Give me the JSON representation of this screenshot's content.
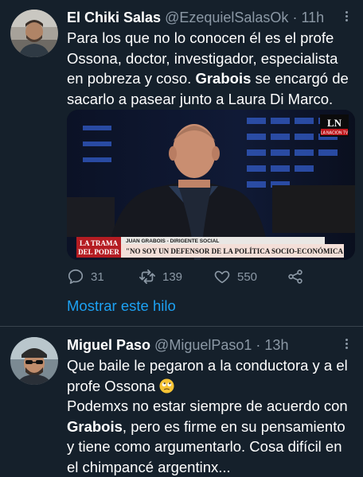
{
  "tweets": [
    {
      "author_name": "El Chiki Salas",
      "handle": "@EzequielSalasOk",
      "separator": "·",
      "time": "11h",
      "text_parts": [
        "Para los que no lo conocen él es el profe Ossona, doctor, investigador, especialista en pobreza y coso. ",
        "Grabois",
        " se encargó de sacarlo a pasear junto a Laura Di Marco."
      ],
      "media": {
        "channel_logo": "LN",
        "channel_sub": "LA NACION TV",
        "show_title_1": "LA TRAMA",
        "show_title_2": "DEL PODER",
        "lower_third_name": "JUAN GRABOIS - DIRIGENTE SOCIAL",
        "lower_third_quote": "\"NO SOY UN DEFENSOR DE LA POLÍTICA SOCIO-ECONÓMICA"
      },
      "reply_count": "31",
      "retweet_count": "139",
      "like_count": "550",
      "show_thread": "Mostrar este hilo"
    },
    {
      "author_name": "Miguel Paso",
      "handle": "@MiguelPaso1",
      "separator": "·",
      "time": "13h",
      "text_line1": "Que baile le pegaron a la conductora y a el profe Ossona",
      "text_parts": [
        "Podemxs no estar siempre de acuerdo con ",
        "Grabois",
        ", pero es firme en su pensamiento y tiene como argumentarlo. Cosa difícil en el chimpancé argentinx..."
      ]
    }
  ],
  "colors": {
    "background": "#15202b",
    "secondary_text": "#8b98a5",
    "link": "#1da1f2",
    "divider": "#38444d"
  },
  "icons": [
    "more-icon",
    "reply-icon",
    "retweet-icon",
    "like-icon",
    "share-icon",
    "rolling-eyes-emoji"
  ]
}
